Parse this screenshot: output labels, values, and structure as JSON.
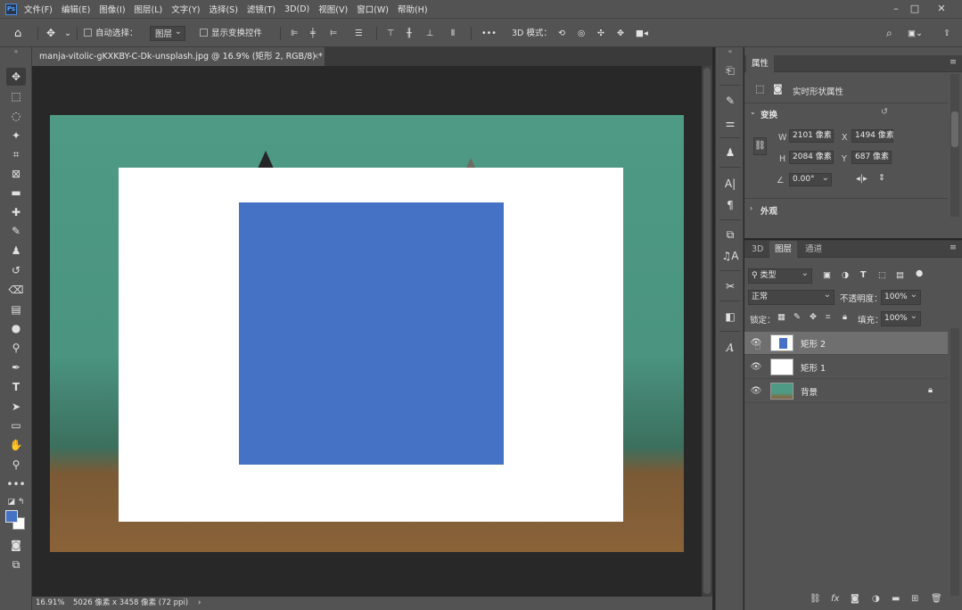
{
  "menubar": {
    "logo": "Ps",
    "items": [
      "文件(F)",
      "编辑(E)",
      "图像(I)",
      "图层(L)",
      "文字(Y)",
      "选择(S)",
      "滤镜(T)",
      "3D(D)",
      "视图(V)",
      "窗口(W)",
      "帮助(H)"
    ]
  },
  "options": {
    "auto_select_label": "自动选择：",
    "auto_select_value": "图层",
    "show_transform_label": "显示变换控件",
    "more": "•••",
    "mode_3d_label": "3D 模式："
  },
  "document": {
    "tab_title": "manja-vitolic-gKXKBY-C-Dk-unsplash.jpg @ 16.9% (矩形 2, RGB/8) *",
    "close": "×"
  },
  "status": {
    "zoom": "16.91%",
    "info": "5026 像素 x 3458 像素 (72 ppi)",
    "arrow": "›"
  },
  "colors": {
    "foreground": "#4572c4",
    "background": "#ffffff",
    "rect2_fill": "#4572c4",
    "rect1_fill": "#ffffff"
  },
  "properties": {
    "tab": "属性",
    "subtitle": "实时形状属性",
    "section_transform": "变换",
    "w_label": "W",
    "w_value": "2101 像素",
    "x_label": "X",
    "x_value": "1494 像素",
    "h_label": "H",
    "h_value": "2084 像素",
    "y_label": "Y",
    "y_value": "687 像素",
    "angle_value": "0.00°",
    "section_appearance": "外观"
  },
  "layers": {
    "tabs": [
      "3D",
      "图层",
      "通道"
    ],
    "active_tab": "图层",
    "filter_label": "类型",
    "blend_mode": "正常",
    "opacity_label": "不透明度：",
    "opacity_value": "100%",
    "lock_label": "锁定：",
    "fill_label": "填充：",
    "fill_value": "100%",
    "items": [
      {
        "name": "矩形 2",
        "selected": true
      },
      {
        "name": "矩形 1",
        "selected": false
      },
      {
        "name": "背景",
        "selected": false,
        "locked": true
      }
    ]
  }
}
